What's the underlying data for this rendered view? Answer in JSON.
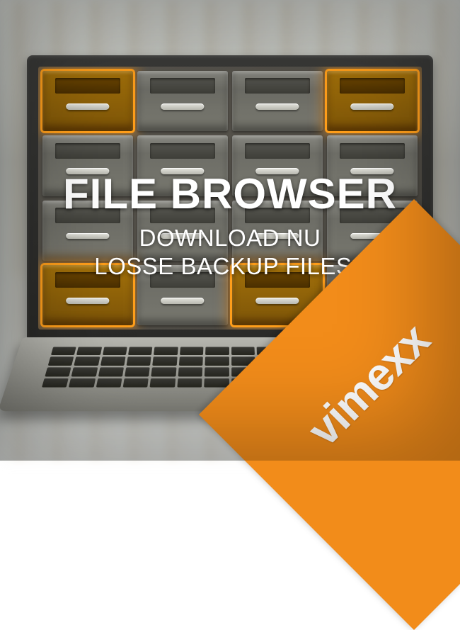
{
  "hero": {
    "title": "FILE BROWSER",
    "subtitle_line1": "DOWNLOAD NU",
    "subtitle_line2": "LOSSE BACKUP FILES !"
  },
  "badge": {
    "brand": "vimexx",
    "color": "#f28c1a"
  }
}
